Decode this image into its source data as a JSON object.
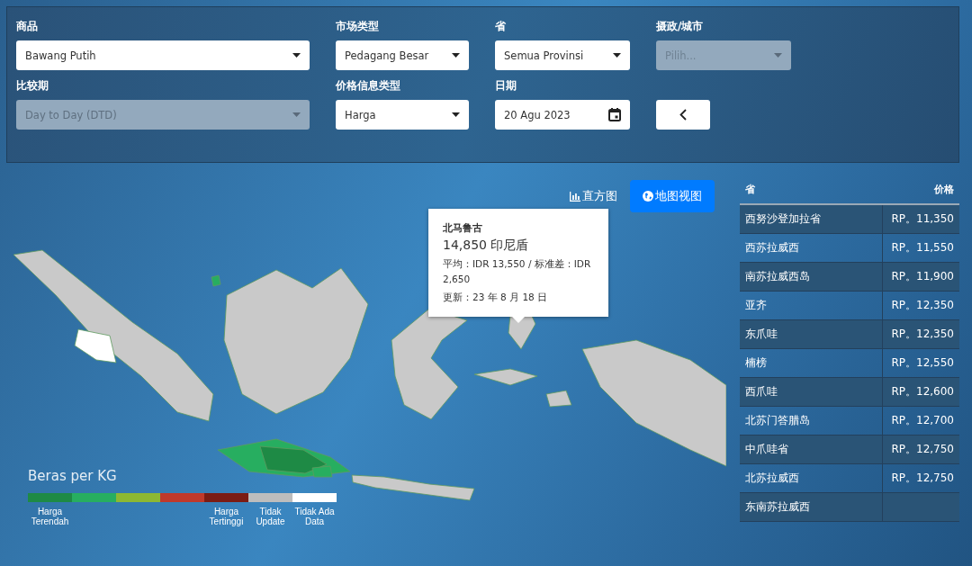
{
  "filters": [
    {
      "kind": "select",
      "label": "商品",
      "value": "Bawang Putih",
      "disabled": false
    },
    {
      "kind": "select",
      "label": "市场类型",
      "value": "Pedagang Besar",
      "disabled": false
    },
    {
      "kind": "select",
      "label": "省",
      "value": "Semua Provinsi",
      "disabled": false
    },
    {
      "kind": "select",
      "label": "摄政/城市",
      "placeholder": "Pilih...",
      "disabled": true
    },
    {
      "kind": "select",
      "label": "比较期",
      "value": "Day to Day (DTD)",
      "disabled": true
    },
    {
      "kind": "select",
      "label": "价格信息类型",
      "value": "Harga",
      "disabled": false
    },
    {
      "kind": "date",
      "label": "日期",
      "value": "20 Agu 2023",
      "disabled": false
    },
    {
      "kind": "back_button",
      "disabled": false
    }
  ],
  "view_toggle": [
    {
      "label": "直方图",
      "kind": "chart",
      "selected": false
    },
    {
      "label": "地图视图",
      "kind": "map",
      "selected": true
    }
  ],
  "tooltip": {
    "title": "北马鲁古",
    "price": "14,850 印尼盾",
    "stats": "平均：IDR 13,550 / 标准差：IDR 2,650",
    "updated": "更新：23 年 8 月 18 日"
  },
  "legend": {
    "title": "Beras per KG",
    "segments": [
      {
        "color": "#1e8a45",
        "label": "Harga Terendah"
      },
      {
        "color": "#27ae60"
      },
      {
        "color": "#8db832"
      },
      {
        "color": "#c0392b"
      },
      {
        "color": "#7b1c14",
        "label": "Harga Tertinggi"
      },
      {
        "color": "#bdbdbd",
        "label": "Tidak Update"
      },
      {
        "color": "#ffffff",
        "label": "Tidak Ada Data"
      }
    ]
  },
  "table": {
    "columns": [
      "省",
      "价格"
    ],
    "rows": [
      {
        "province": "西努沙登加拉省",
        "price": "RP。11,350"
      },
      {
        "province": "西苏拉威西",
        "price": "RP。11,550"
      },
      {
        "province": "南苏拉威西岛",
        "price": "RP。11,900"
      },
      {
        "province": "亚齐",
        "price": "RP。12,350"
      },
      {
        "province": "东爪哇",
        "price": "RP。12,350"
      },
      {
        "province": "楠榜",
        "price": "RP。12,550"
      },
      {
        "province": "西爪哇",
        "price": "RP。12,600"
      },
      {
        "province": "北苏门答腊岛",
        "price": "RP。12,700"
      },
      {
        "province": "中爪哇省",
        "price": "RP。12,750"
      },
      {
        "province": "北苏拉威西",
        "price": "RP。12,750"
      },
      {
        "province": "东南苏拉威西"
      }
    ]
  }
}
